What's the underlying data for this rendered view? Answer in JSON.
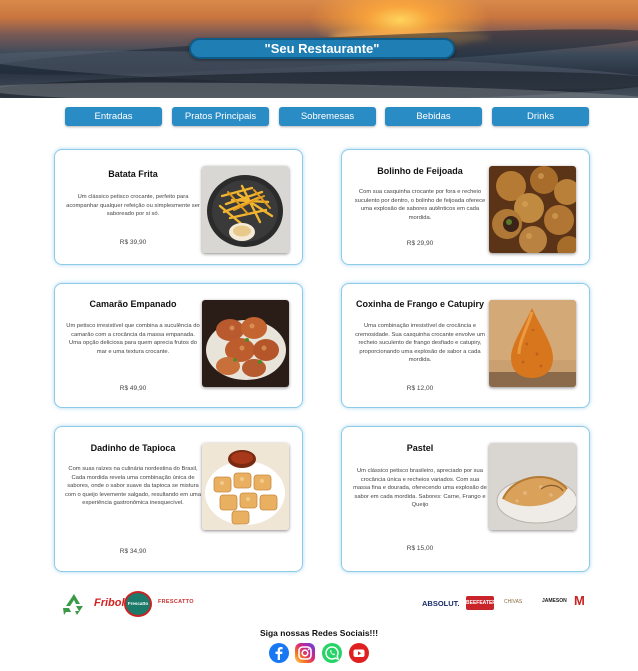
{
  "header": {
    "title": "\"Seu Restaurante\""
  },
  "nav": [
    "Entradas",
    "Pratos Principais",
    "Sobremesas",
    "Bebidas",
    "Drinks"
  ],
  "menu": [
    {
      "name": "Batata Frita",
      "description": "Um clássico petisco crocante, perfeito para acompanhar qualquer refeição ou simplesmente ser saboreado por si só.",
      "price": "R$ 39,90"
    },
    {
      "name": "Bolinho de Feijoada",
      "description": "Com sua casquinha crocante por fora e recheio suculento por dentro, o bolinho de feijoada oferece uma explosão de sabores autênticos em cada mordida.",
      "price": "R$ 29,90"
    },
    {
      "name": "Camarão Empanado",
      "description": "Um petisco irresistível que combina a suculência do camarão com a crocância da massa empanada. Uma opção deliciosa para quem aprecia frutos do mar e uma textura crocante.",
      "price": "R$ 49,90"
    },
    {
      "name": "Coxinha de Frango e Catupiry",
      "description": "Uma combinação irresistível de crocância e cremosidade. Sua casquinha crocante envolve um recheio suculento de frango desfiado e catupiry, proporcionando uma explosão de sabor a cada mordida.",
      "price": "R$ 12,00"
    },
    {
      "name": "Dadinho de Tapioca",
      "description": "Com suas raízes na culinária nordestina do Brasil, Cada mordida revela uma combinação única de sabores, onde o sabor suave da tapioca se mistura com o queijo levemente salgado, resultando em uma experiência gastronômica inesquecível.",
      "price": "R$ 34,90"
    },
    {
      "name": "Pastel",
      "description": "Um clássico petisco brasileiro, apreciado por sua crocância única e recheios variados. Com sua massa fina e dourada, oferecendo uma explosão de sabor em cada mordida. Sabores: Carne, Frango e Queijo",
      "price": "R$ 15,00"
    }
  ],
  "partners_left": [
    "Fribol",
    "Frescatto",
    "FRESCATTO"
  ],
  "partners_right": [
    "ABSOLUT.",
    "BEEFEATER",
    "CHIVAS",
    "JAMESON",
    "M"
  ],
  "social": {
    "title": "Siga nossas Redes Sociais!!!",
    "icons": [
      "facebook-icon",
      "instagram-icon",
      "whatsapp-icon",
      "youtube-icon"
    ]
  },
  "colors": {
    "accent": "#2a8cc4",
    "card_border": "#8ecbe8",
    "title_pill": "#1f7fb4"
  }
}
